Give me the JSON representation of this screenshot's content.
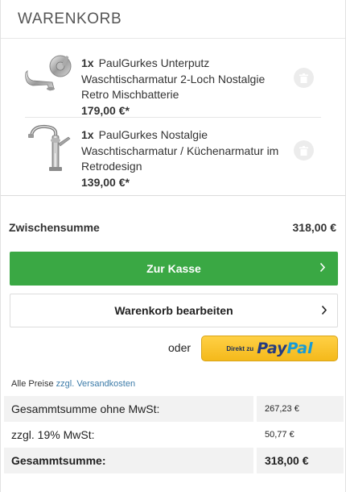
{
  "header": {
    "title": "WARENKORB"
  },
  "cart": {
    "items": [
      {
        "qty": "1x",
        "name": "PaulGurkes Unterputz Waschtischarmatur 2-Loch Nostalgie Retro Mischbatterie",
        "price": "179,00 €*",
        "icon": "tap-wall-mounted-icon"
      },
      {
        "qty": "1x",
        "name": "PaulGurkes Nostalgie Waschtischarmatur / Küchenarmatur im Retrodesign",
        "price": "139,00 €*",
        "icon": "tap-standing-icon"
      }
    ]
  },
  "subtotal": {
    "label": "Zwischensumme",
    "value": "318,00 €"
  },
  "actions": {
    "checkout": "Zur Kasse",
    "edit": "Warenkorb bearbeiten",
    "or": "oder",
    "paypal_prefix": "Direkt zu",
    "paypal_pay": "Pay",
    "paypal_pal": "Pal"
  },
  "vat_note": {
    "text": "Alle Preise",
    "link": "zzgl. Versandkosten"
  },
  "totals": [
    {
      "label": "Gesammtsumme ohne MwSt:",
      "value": "267,23 €"
    },
    {
      "label": "zzgl. 19% MwSt:",
      "value": "50,77 €"
    },
    {
      "label": "Gesammtsumme:",
      "value": "318,00 €"
    }
  ],
  "colors": {
    "accent": "#3aa844",
    "paypal_bg": "#f4b91b",
    "link": "#3c7ba8"
  }
}
